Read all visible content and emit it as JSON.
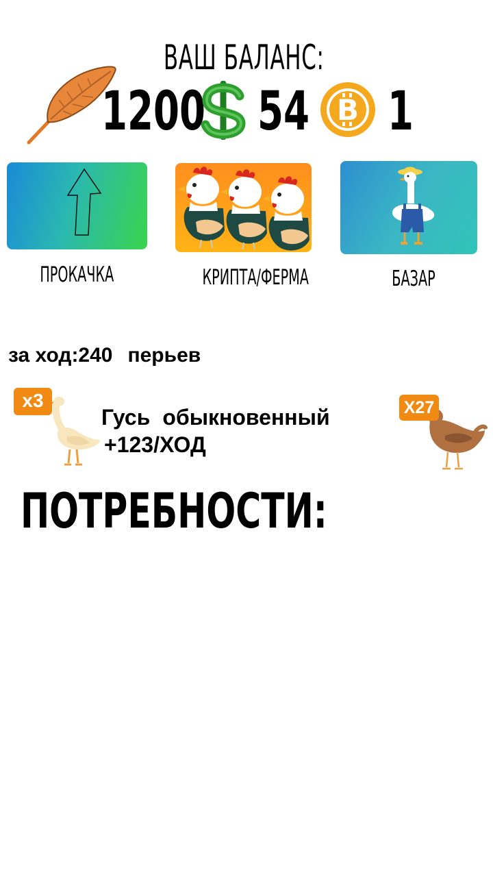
{
  "balance": {
    "title": "ВАШ БАЛАНС:",
    "feathers": "1200",
    "dollars": "54",
    "coins": "1",
    "icons": [
      "feather-icon",
      "dollar-icon",
      "bitcoin-icon"
    ]
  },
  "menu": [
    {
      "label": "ПРОКАЧКА",
      "icon": "arrow-up-icon"
    },
    {
      "label": "КРИПТА/ФЕРМА",
      "icon": "roosters-icon"
    },
    {
      "label": "БАЗАР",
      "icon": "farmer-goose-icon"
    }
  ],
  "per_turn": {
    "prefix": "за ход:240",
    "suffix": "перьев"
  },
  "birds": {
    "goose_badge": "x3",
    "hen_badge": "X27",
    "name_first": "Гусь",
    "name_second": "обыкновенный",
    "income": "+123/ХОД"
  },
  "needs": {
    "title": "ПОТРЕБНОСТИ:"
  },
  "colors": {
    "badge": "#f08a12",
    "dollar": "#2e9e2e",
    "bitcoin": "#f4a81d",
    "feather": "#e8873a"
  }
}
